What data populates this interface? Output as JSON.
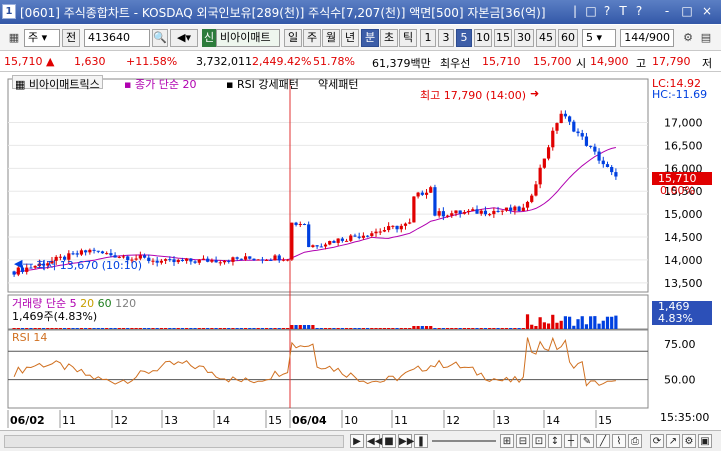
{
  "title": {
    "number": "1",
    "text": "[0601] 주식종합차트 - KOSDAQ 외국인보유[289(천)] 주식수[7,207(천)] 액면[500] 자본금[36(억)]",
    "buttons": [
      "|",
      "□",
      "?",
      "T",
      "?",
      "-",
      "□",
      "×"
    ]
  },
  "toolbar": {
    "market": "주",
    "type": "전",
    "code": "413640",
    "name": "비아이매트",
    "name_prefix": "신",
    "periods": [
      "일",
      "주",
      "월",
      "년",
      "분",
      "초",
      "틱"
    ],
    "selected_period": "분",
    "intervals": [
      "1",
      "3",
      "5",
      "10",
      "15",
      "30",
      "45",
      "60"
    ],
    "selected_interval": "5",
    "interval_value": "5",
    "count": "144/900"
  },
  "quote": {
    "price": "15,710",
    "change": "1,630",
    "change_pct": "+11.58%",
    "volume": "3,732,011",
    "vol_pct": "2,449.42%",
    "vol_pct2": "51.78%",
    "amount": "61,379백만",
    "best_ask_label": "최우선",
    "best_ask": "15,710",
    "best_bid": "15,700",
    "open_label": "시",
    "open": "14,900",
    "high_label": "고",
    "high": "17,790",
    "low_label": "저"
  },
  "price_panel": {
    "name": "비아이매트릭스",
    "ma_label": "종가 단순 20",
    "rsi_legend": "RSI 강세패턴",
    "rsi_legend2": "약세패턴",
    "high_annotation": "최고 17,790 (14:00)",
    "low_annotation": "최저 13,670 (10:10)",
    "lc": "LC:14.92",
    "hc": "HC:-11.69",
    "current_price": "15,710",
    "current_pct": "0.00%",
    "y_ticks": [
      "17,000",
      "16,500",
      "16,000",
      "15,500",
      "15,000",
      "14,500",
      "14,000",
      "13,500"
    ]
  },
  "volume_panel": {
    "label": "거래량",
    "ma_label": "단순",
    "ma_values": [
      "5",
      "20",
      "60",
      "120"
    ],
    "value_text": "1,469주(4.83%)",
    "current": "1,469",
    "current_pct": "4.83%"
  },
  "rsi_panel": {
    "label": "RSI 14",
    "y_ticks": [
      "75.00",
      "50.00"
    ]
  },
  "x_axis": {
    "labels": [
      "06/02",
      "11",
      "12",
      "13",
      "14",
      "15",
      "06/04",
      "10",
      "11",
      "12",
      "13",
      "14",
      "15"
    ],
    "time": "15:35:00"
  },
  "colors": {
    "up": "#e00000",
    "down": "#0040e0",
    "ma": "#b000b0",
    "rsi": "#d07020",
    "current_bg": "#e00000",
    "title_bg": "#3a5eac"
  },
  "icons": [
    "prev-icon",
    "play-icon",
    "stop-icon",
    "pause-icon",
    "next-icon",
    "slider-icon",
    "zoom-in-icon",
    "zoom-out-icon",
    "settings-icon"
  ]
}
